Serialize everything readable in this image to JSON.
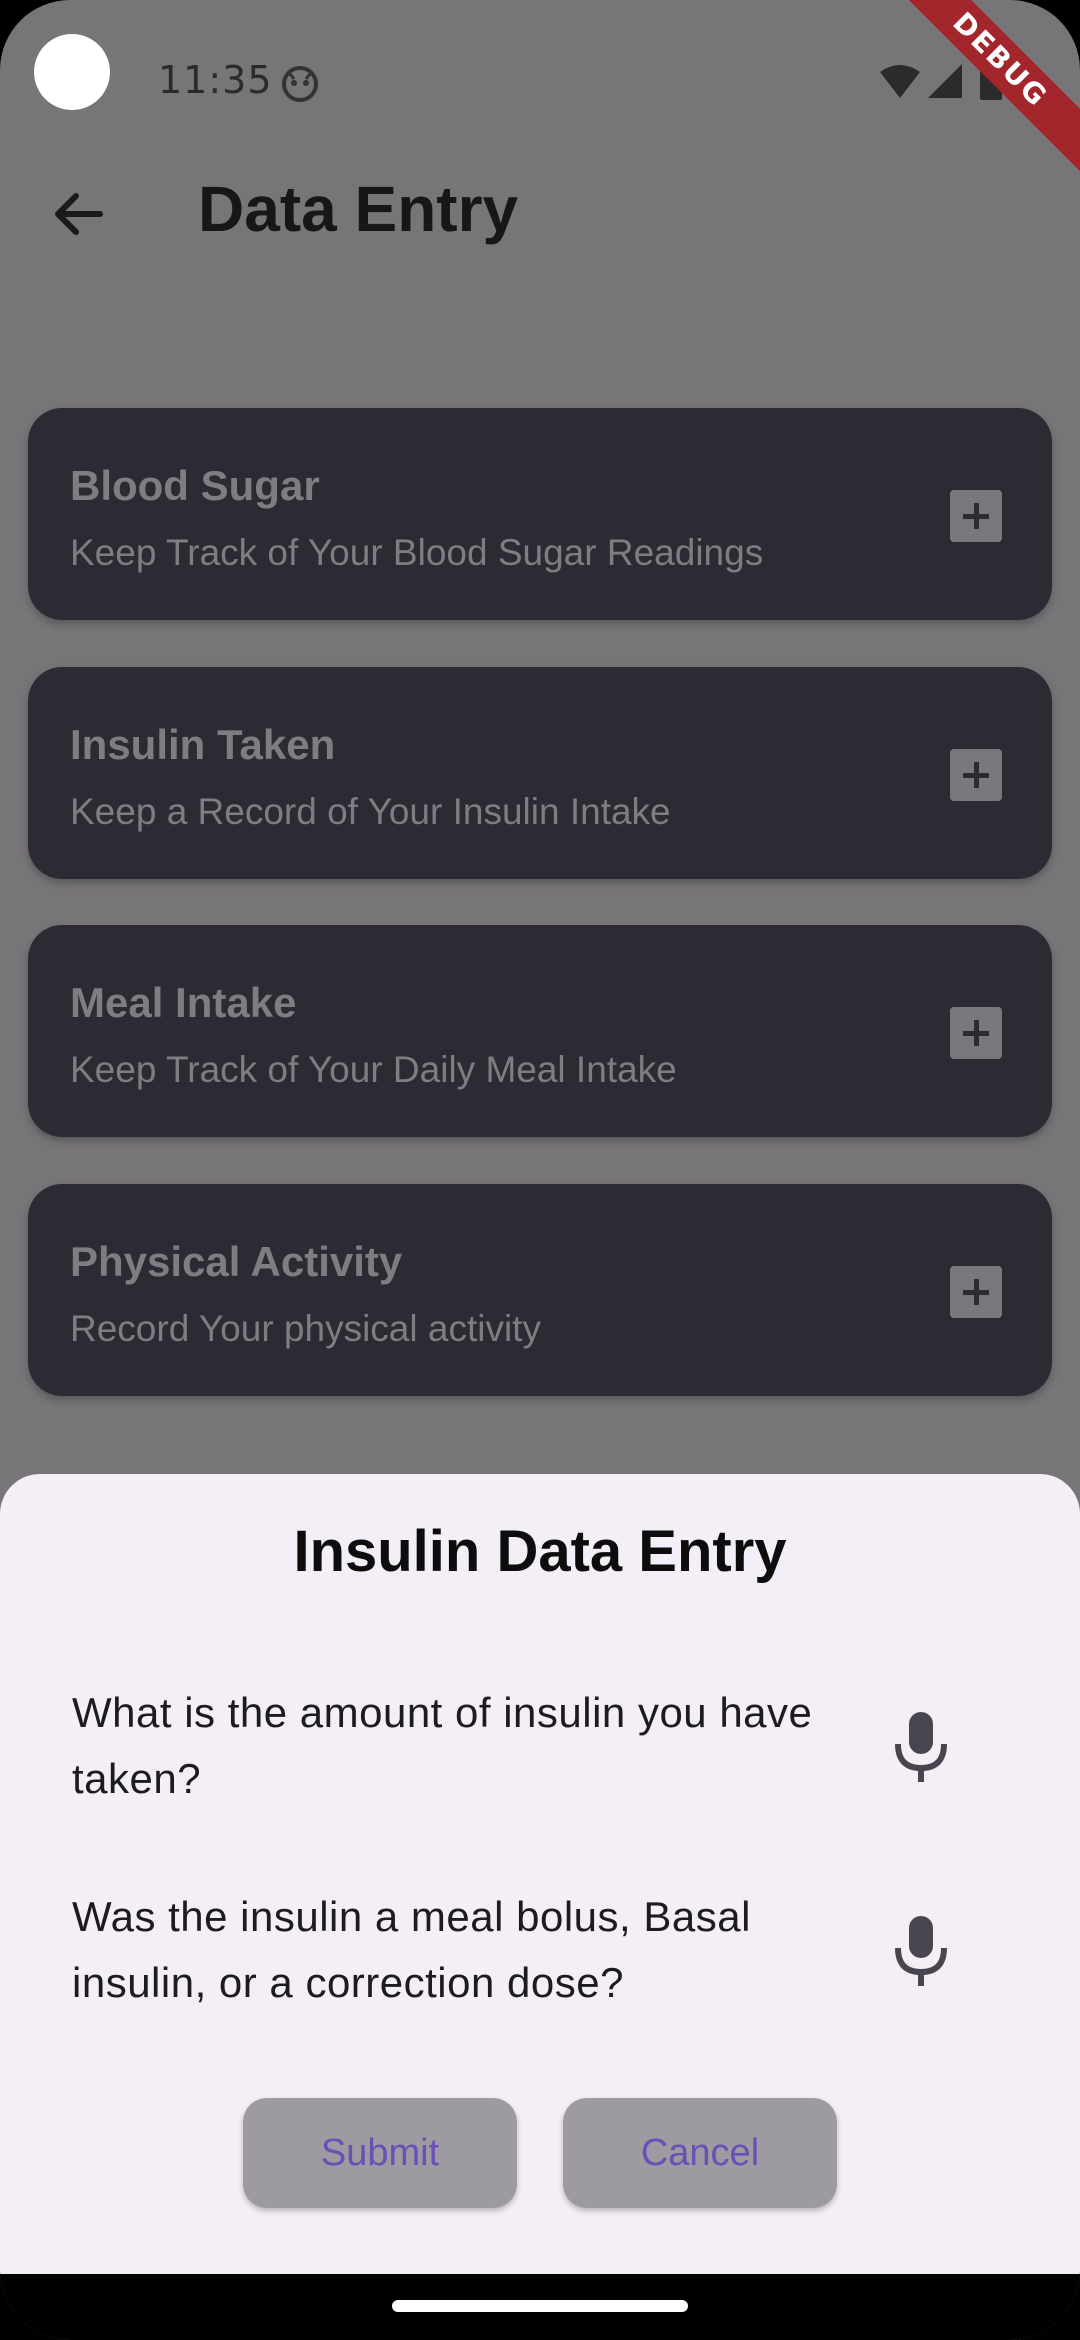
{
  "status_bar": {
    "time": "11:35",
    "icons": [
      "android-face-icon",
      "wifi-icon",
      "signal-icon",
      "battery-icon"
    ],
    "debug_label": "DEBUG"
  },
  "app_bar": {
    "back_icon": "arrow-left-icon",
    "title": "Data Entry"
  },
  "cards": [
    {
      "title": "Blood Sugar",
      "subtitle": "Keep Track of Your Blood Sugar Readings",
      "icon": "plus-box-icon"
    },
    {
      "title": "Insulin Taken",
      "subtitle": "Keep a Record of Your Insulin Intake",
      "icon": "plus-box-icon"
    },
    {
      "title": "Meal Intake",
      "subtitle": "Keep Track of Your Daily Meal Intake",
      "icon": "plus-box-icon"
    },
    {
      "title": "Physical Activity",
      "subtitle": "Record Your physical activity",
      "icon": "plus-box-icon"
    }
  ],
  "sheet": {
    "title": "Insulin Data Entry",
    "questions": [
      {
        "text": "What is the amount of insulin you have taken?",
        "icon": "microphone-icon"
      },
      {
        "text": "Was the insulin a meal bolus, Basal insulin, or a correction dose?",
        "icon": "microphone-icon"
      }
    ],
    "submit_label": "Submit",
    "cancel_label": "Cancel"
  },
  "colors": {
    "scrim_background": "#787578",
    "card_background": "#2d2a33",
    "sheet_background": "#f4eff6",
    "button_text": "#6a4fb4",
    "debug_ribbon": "#a3262d"
  }
}
